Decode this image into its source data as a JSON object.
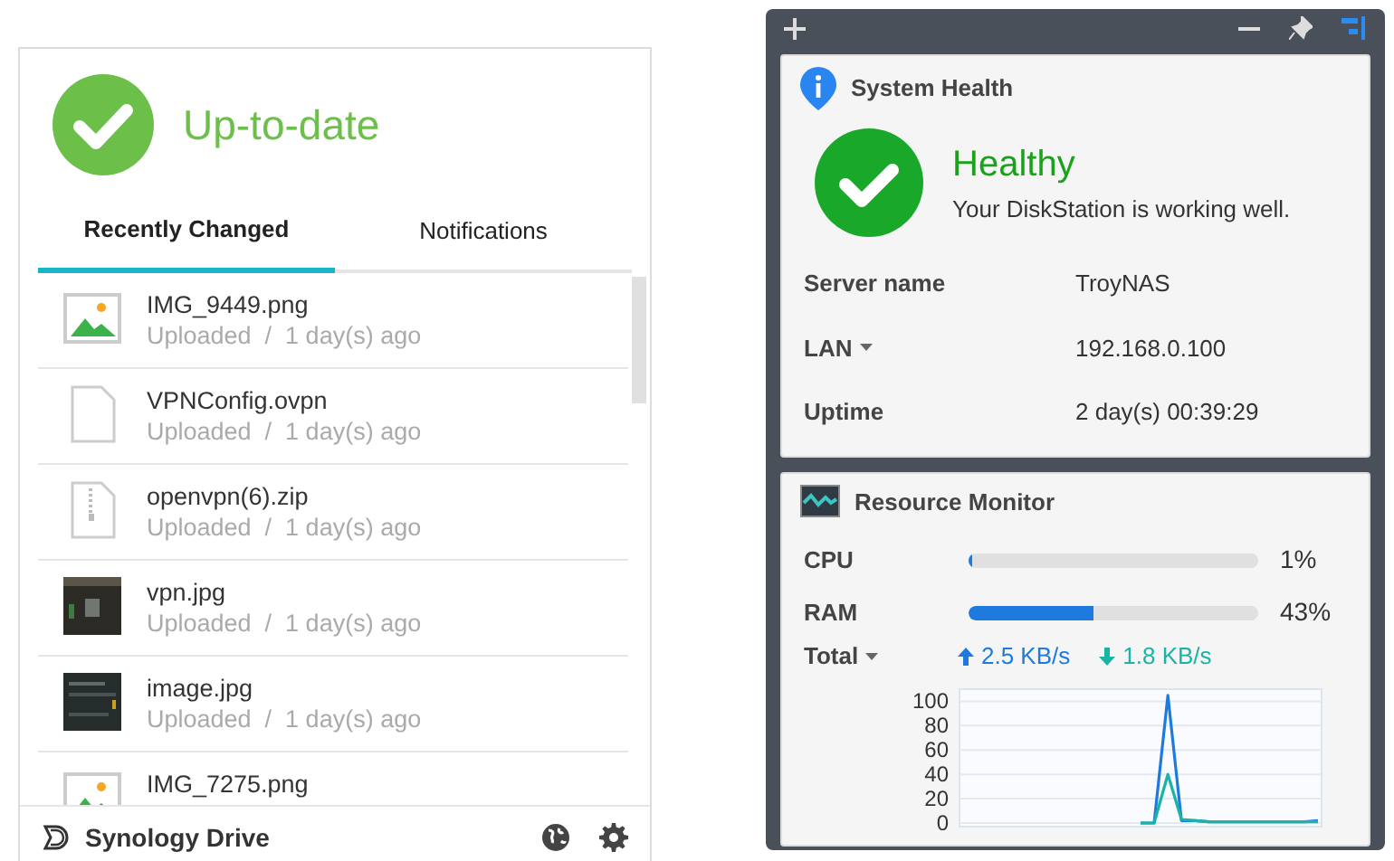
{
  "drive_panel": {
    "status": "Up-to-date",
    "tabs": [
      {
        "label": "Recently Changed",
        "selected": true
      },
      {
        "label": "Notifications",
        "selected": false
      }
    ],
    "files": [
      {
        "name": "IMG_9449.png",
        "kind": "image",
        "status": "Uploaded  /  1 day(s) ago"
      },
      {
        "name": "VPNConfig.ovpn",
        "kind": "file",
        "status": "Uploaded  /  1 day(s) ago"
      },
      {
        "name": "openvpn(6).zip",
        "kind": "zip",
        "status": "Uploaded  /  1 day(s) ago"
      },
      {
        "name": "vpn.jpg",
        "kind": "photo",
        "status": "Uploaded  /  1 day(s) ago"
      },
      {
        "name": "image.jpg",
        "kind": "screenshot",
        "status": "Uploaded  /  1 day(s) ago"
      },
      {
        "name": "IMG_7275.png",
        "kind": "image"
      }
    ],
    "footer": {
      "title": "Synology Drive"
    }
  },
  "widgets": {
    "system_health": {
      "title": "System Health",
      "status": "Healthy",
      "message": "Your DiskStation is working well.",
      "info": [
        {
          "label": "Server name",
          "value": "TroyNAS",
          "dropdown": false
        },
        {
          "label": "LAN",
          "value": "192.168.0.100",
          "dropdown": true
        },
        {
          "label": "Uptime",
          "value": "2 day(s) 00:39:29",
          "dropdown": false
        }
      ]
    },
    "resource_monitor": {
      "title": "Resource Monitor",
      "meters": [
        {
          "label": "CPU",
          "level": 0.01,
          "reading": "1%"
        },
        {
          "label": "RAM",
          "level": 0.43,
          "reading": "43%"
        }
      ],
      "network": {
        "label": "Total",
        "upload": "2.5 KB/s",
        "download": "1.8 KB/s"
      },
      "chart_data": {
        "type": "line",
        "grid": true,
        "ylim": [
          0,
          110
        ],
        "yticks": [
          0,
          20,
          40,
          60,
          80,
          100
        ],
        "series": [
          {
            "color": "#1f7ae0",
            "values": [
              null,
              null,
              null,
              null,
              null,
              null,
              null,
              null,
              null,
              null,
              null,
              null,
              null,
              0,
              0,
              105,
              2,
              2,
              1,
              1,
              1,
              1,
              1,
              1,
              1,
              1,
              2
            ]
          },
          {
            "color": "#19b4a6",
            "values": [
              null,
              null,
              null,
              null,
              null,
              null,
              null,
              null,
              null,
              null,
              null,
              null,
              null,
              0,
              0,
              40,
              3,
              2,
              1,
              1,
              1,
              1,
              1,
              1,
              1,
              1,
              1
            ]
          }
        ]
      }
    }
  }
}
